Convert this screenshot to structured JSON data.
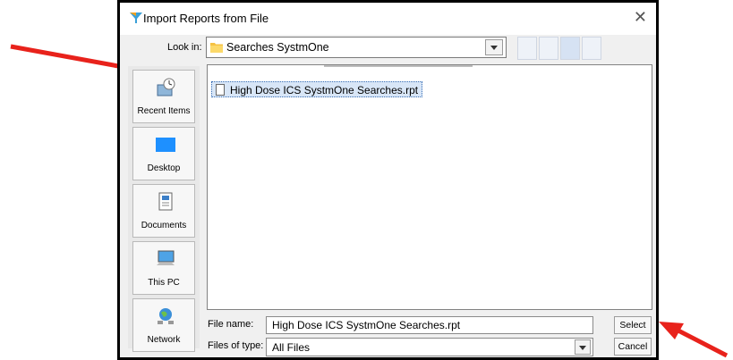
{
  "dialog": {
    "title": "Import Reports from File",
    "look_in_label": "Look in:",
    "look_in_value": "Searches SystmOne"
  },
  "sidebar": {
    "items": [
      {
        "label": "Recent Items",
        "icon": "recent-items-icon"
      },
      {
        "label": "Desktop",
        "icon": "desktop-icon"
      },
      {
        "label": "Documents",
        "icon": "documents-icon"
      },
      {
        "label": "This PC",
        "icon": "this-pc-icon"
      },
      {
        "label": "Network",
        "icon": "network-icon"
      }
    ]
  },
  "file_list": {
    "items": [
      {
        "name": "High Dose ICS SystmOne Searches.rpt",
        "selected": true
      }
    ]
  },
  "footer": {
    "file_name_label": "File name:",
    "file_name_value": "High Dose ICS SystmOne Searches.rpt",
    "file_type_label": "Files of type:",
    "file_type_value": "All Files",
    "select_label": "Select",
    "cancel_label": "Cancel"
  },
  "colors": {
    "annotation_arrow": "#e8221b",
    "selection": "#d8e6f7",
    "accent": "#3a6fb5"
  }
}
